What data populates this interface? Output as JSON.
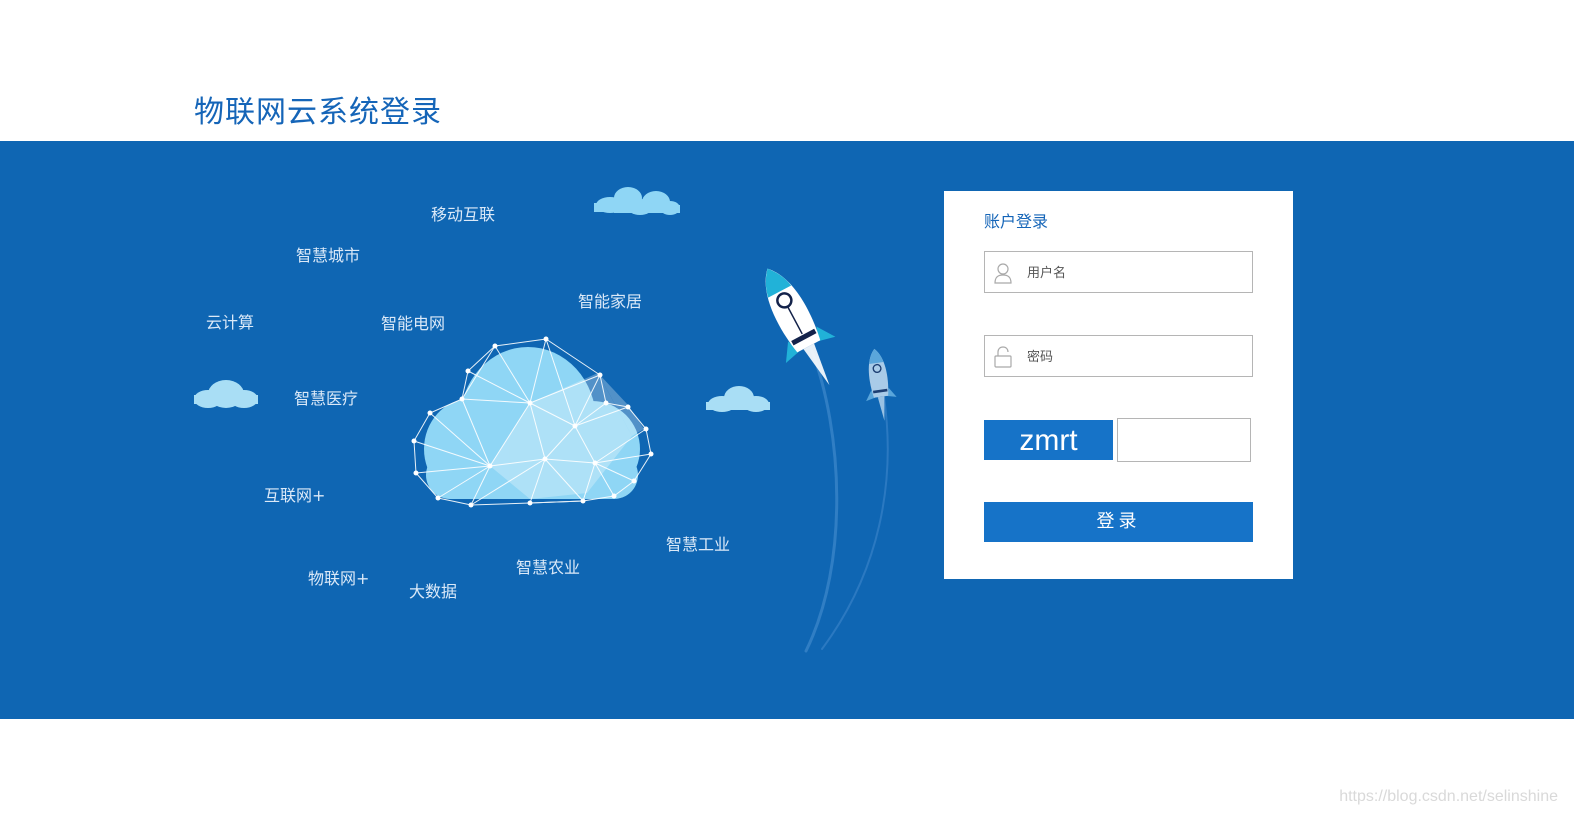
{
  "header": {
    "title": "物联网云系统登录"
  },
  "illustration": {
    "keywords": [
      "移动互联",
      "智慧城市",
      "云计算",
      "智能电网",
      "智能家居",
      "智慧医疗",
      "互联网+",
      "物联网+",
      "大数据",
      "智慧农业",
      "智慧工业"
    ]
  },
  "login": {
    "title": "账户登录",
    "username_placeholder": "用户名",
    "password_placeholder": "密码",
    "captcha_text": "zmrt",
    "captcha_value": "",
    "submit_label": "登录"
  },
  "watermark": "https://blog.csdn.net/selinshine",
  "colors": {
    "brand": "#1565b8",
    "banner": "#0f66b3",
    "button": "#1673c8",
    "cloud": "#8fd6f5"
  }
}
